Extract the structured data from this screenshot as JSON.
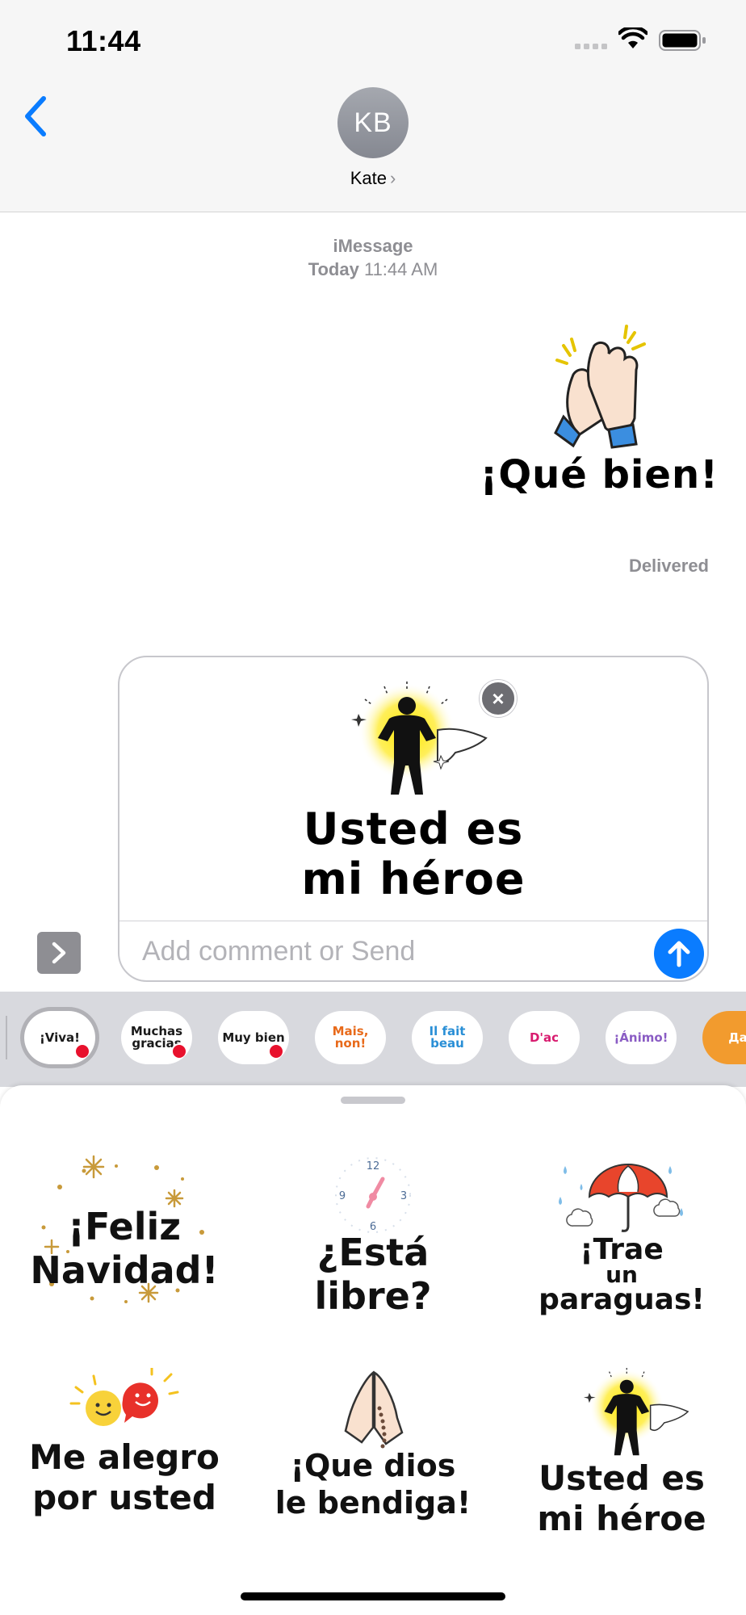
{
  "status_bar": {
    "time": "11:44"
  },
  "header": {
    "back_label": "Back",
    "avatar_initials": "KB",
    "contact_name": "Kate",
    "contact_chevron": "›"
  },
  "conversation": {
    "service": "iMessage",
    "day": "Today",
    "time": "11:44 AM",
    "sent_sticker": {
      "text": "¡Qué bien!",
      "icon": "clapping-hands-icon"
    },
    "status": "Delivered"
  },
  "compose": {
    "staged_sticker": {
      "line1": "Usted es",
      "line2": "mi héroe",
      "icon": "superhero-silhouette-icon"
    },
    "remove_label": "×",
    "comment_placeholder": "Add comment or Send",
    "comment_value": ""
  },
  "sticker_packs": [
    {
      "label": "¡Viva!",
      "color": "#1a1a1a",
      "selected": true,
      "badge": true
    },
    {
      "label": "Muchas gracias",
      "color": "#1a1a1a",
      "selected": false,
      "badge": true
    },
    {
      "label": "Muy bien",
      "color": "#1a1a1a",
      "selected": false,
      "badge": true
    },
    {
      "label": "Mais, non!",
      "color": "#e86a1a",
      "selected": false,
      "badge": false
    },
    {
      "label": "Il fait beau",
      "color": "#2a8fd6",
      "selected": false,
      "badge": false
    },
    {
      "label": "D'ac",
      "color": "#d81b6f",
      "selected": false,
      "badge": false
    },
    {
      "label": "¡Ánimo!",
      "color": "#8a5cc4",
      "selected": false,
      "badge": false
    },
    {
      "label": "Да",
      "color": "#ffffff",
      "selected": false,
      "badge": false
    }
  ],
  "stickers": [
    {
      "line1": "¡Feliz",
      "line2": "Navidad!",
      "line3": "",
      "icon": "snowflakes-icon"
    },
    {
      "line1": "¿Está",
      "line2": "libre?",
      "line3": "",
      "icon": "clock-icon",
      "clock": [
        "12",
        "3",
        "6",
        "9"
      ]
    },
    {
      "line1": "¡Trae",
      "line2": "un",
      "line3": "paraguas!",
      "icon": "umbrella-rain-icon"
    },
    {
      "line1": "Me alegro",
      "line2": "por usted",
      "line3": "",
      "icon": "happy-faces-icon"
    },
    {
      "line1": "¡Que dios",
      "line2": "le bendiga!",
      "line3": "",
      "icon": "praying-hands-icon"
    },
    {
      "line1": "Usted es",
      "line2": "mi héroe",
      "line3": "",
      "icon": "superhero-silhouette-icon"
    }
  ],
  "colors": {
    "accent": "#0a7cff",
    "muted": "#8e8e93",
    "badge": "#e8112d"
  }
}
